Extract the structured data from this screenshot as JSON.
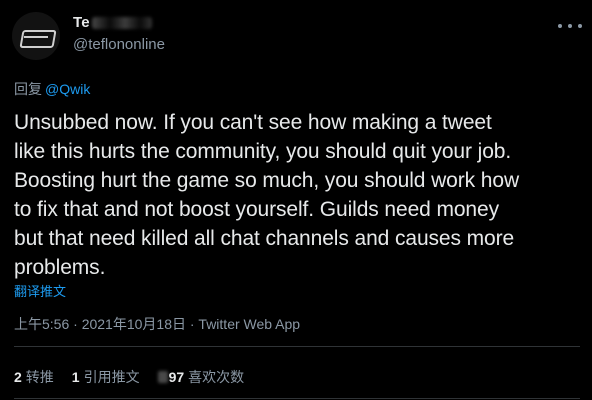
{
  "author": {
    "display_name": "Te",
    "handle": "@teflononline"
  },
  "reply": {
    "prefix": "回复",
    "mention": "@Qwik"
  },
  "tweet": {
    "text": "Unsubbed now. If you can't see how making a tweet\nlike this hurts the community, you should quit your job.\nBoosting hurt the game so much, you should work how\nto fix that and not boost yourself. Guilds need money\nbut that need killed all chat channels and causes more\nproblems.",
    "translate_label": "翻译推文",
    "timestamp": "上午5:56 · 2021年10月18日 · Twitter Web App"
  },
  "stats": {
    "retweets_count": "2",
    "retweets_label": "转推",
    "quotes_count": "1",
    "quotes_label": "引用推文",
    "likes_count": "97",
    "likes_label": "喜欢次数"
  },
  "icons": {
    "more": "more-icon"
  },
  "colors": {
    "background": "#000000",
    "text": "#e7e9ea",
    "secondary": "#8b98a5",
    "accent": "#1d9bf0",
    "divider": "#2f3336"
  }
}
